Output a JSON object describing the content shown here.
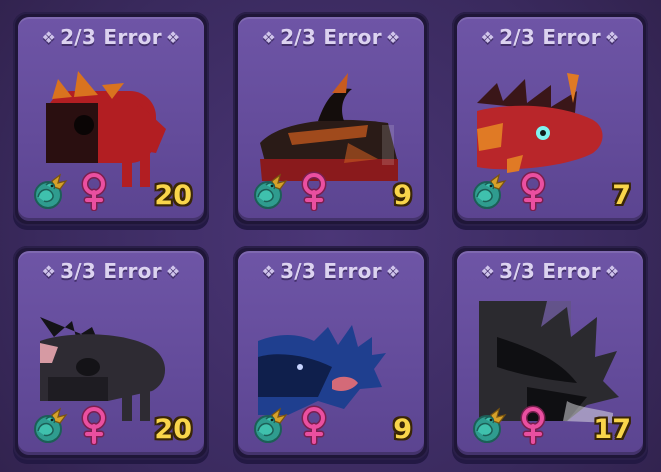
{
  "inventory": {
    "slots": [
      {
        "title": "2/3 Error",
        "level": "20",
        "species_icon": "sea-dragon-icon",
        "gender_icon": "female-icon",
        "pet": "red-dragon",
        "colors": {
          "body": "#b21e22",
          "dark": "#2a0f10",
          "accent": "#d9731f"
        }
      },
      {
        "title": "2/3 Error",
        "level": "9",
        "species_icon": "sea-dragon-icon",
        "gender_icon": "female-icon",
        "pet": "dark-red-dragon",
        "colors": {
          "body": "#2a1b17",
          "dark": "#140d0c",
          "accent": "#c85b1f"
        }
      },
      {
        "title": "2/3 Error",
        "level": "7",
        "species_icon": "sea-dragon-icon",
        "gender_icon": "female-icon",
        "pet": "crimson-dragon",
        "colors": {
          "body": "#b9262a",
          "dark": "#3a1618",
          "accent": "#e07a25"
        }
      },
      {
        "title": "3/3 Error",
        "level": "20",
        "species_icon": "sea-dragon-icon",
        "gender_icon": "female-icon",
        "pet": "black-dragon",
        "colors": {
          "body": "#2e2b33",
          "dark": "#141317",
          "accent": "#d69aa3"
        }
      },
      {
        "title": "3/3 Error",
        "level": "9",
        "species_icon": "sea-dragon-icon",
        "gender_icon": "female-icon",
        "pet": "blue-dragon",
        "colors": {
          "body": "#1f3f8f",
          "dark": "#0f1f4c",
          "accent": "#d46a78"
        }
      },
      {
        "title": "3/3 Error",
        "level": "17",
        "species_icon": "sea-dragon-icon",
        "gender_icon": "female-icon",
        "pet": "shadow-dragon",
        "colors": {
          "body": "#2b2a2f",
          "dark": "#0f0f12",
          "accent": "#5a5860"
        }
      }
    ]
  },
  "theme": {
    "card_face": "#6e55a6",
    "card_frame": "#1f1638",
    "title_color": "#dcd3f0",
    "level_color": "#f9d54b",
    "gender_color": "#ea4fa0",
    "species_teal": "#2f9c8f",
    "species_gold": "#d7a12a"
  }
}
